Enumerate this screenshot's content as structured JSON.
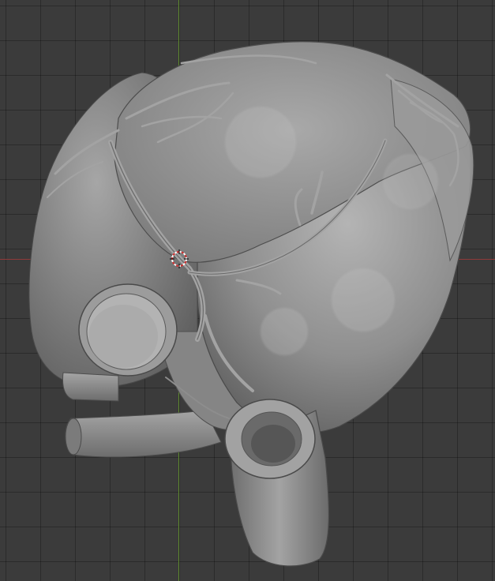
{
  "viewport": {
    "background": "#3b3b3b",
    "grid_color": "#2f2f2f",
    "axis_x_color": "#8f3a3a",
    "axis_y_color": "#5f8a2f"
  },
  "model": {
    "label": "heart",
    "base_color": "#8e8e8e",
    "highlight_color": "#b9b9b9",
    "shadow_color": "#565656"
  },
  "cursor3d": {
    "ring_color": "#d03030",
    "cross_color": "#ffffff"
  }
}
